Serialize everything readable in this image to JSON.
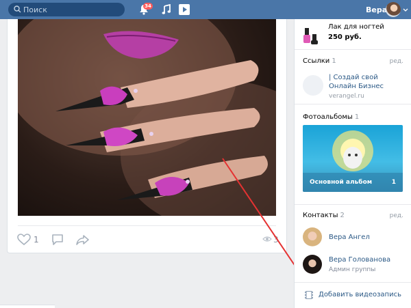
{
  "header": {
    "search_placeholder": "Поиск",
    "notifications_badge": "34",
    "username": "Вера"
  },
  "post": {
    "likes": "1",
    "views": "3"
  },
  "sidebar": {
    "product": {
      "name": "Лак для ногтей",
      "price": "250 руб."
    },
    "links": {
      "title": "Ссылки",
      "count": "1",
      "edit": "ред.",
      "item_title": "| Создай свой Онлайн Бизнес",
      "item_url": "verangel.ru"
    },
    "albums": {
      "title": "Фотоальбомы",
      "count": "1",
      "album_name": "Основной альбом",
      "album_count": "1"
    },
    "contacts": {
      "title": "Контакты",
      "count": "2",
      "edit": "ред.",
      "items": [
        {
          "name": "Вера Ангел",
          "role": ""
        },
        {
          "name": "Вера Голованова",
          "role": "Админ группы"
        }
      ]
    },
    "add_video": "Добавить видеозапись"
  },
  "colors": {
    "header_bg": "#4a76a8",
    "link": "#2a5885",
    "muted": "#939ba5",
    "page_bg": "#edeef0"
  }
}
